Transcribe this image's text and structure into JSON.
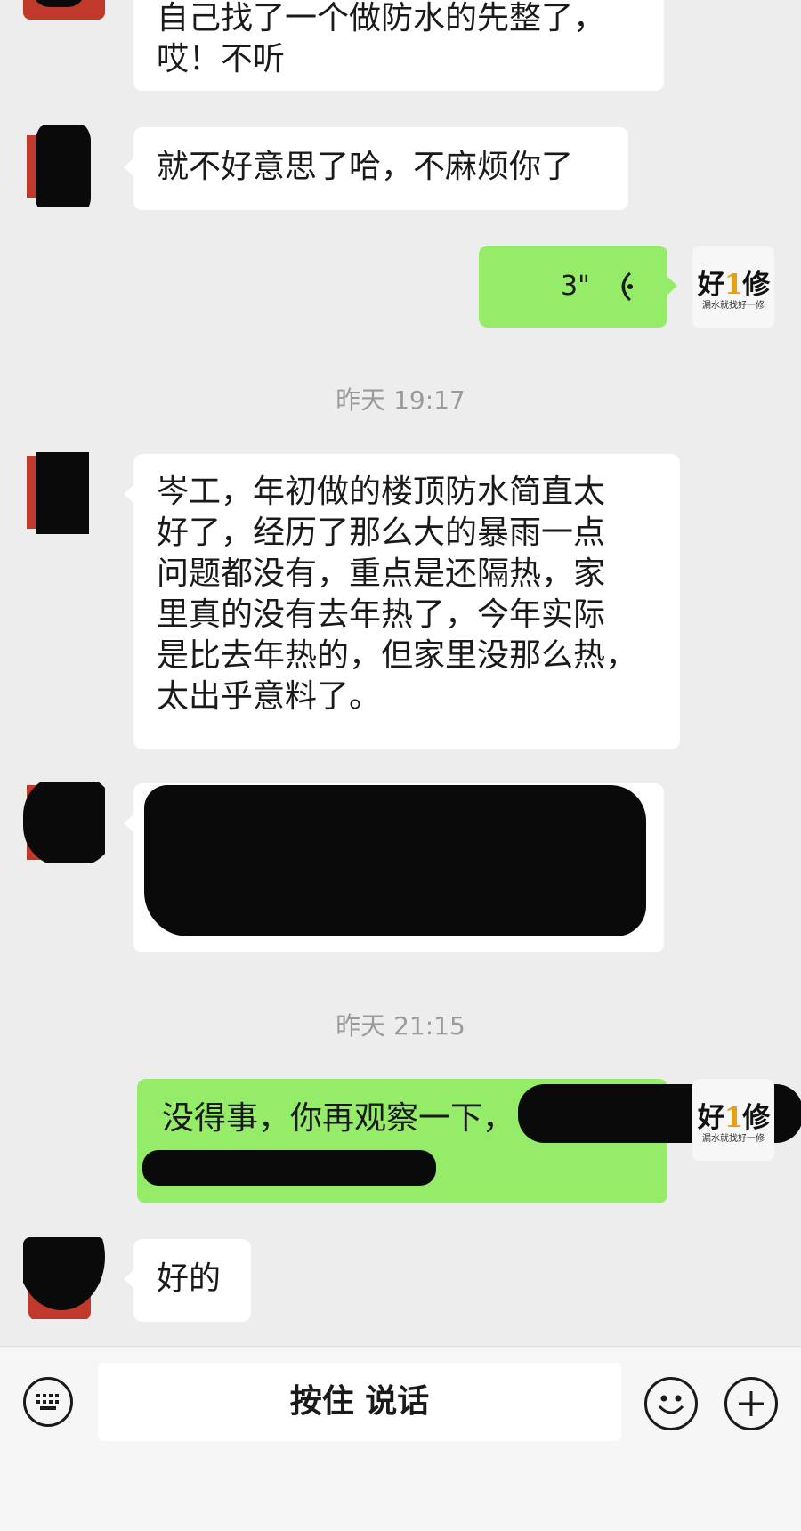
{
  "messages": [
    {
      "side": "left",
      "text_lines": [
        "自己找了一个做防水的先整了，",
        "哎！不听"
      ]
    },
    {
      "side": "left",
      "text": "就不好意思了哈，不麻烦你了"
    },
    {
      "side": "right",
      "type": "voice",
      "duration": "3\""
    },
    {
      "timestamp": "昨天 19:17"
    },
    {
      "side": "left",
      "text_lines": [
        "岑工，年初做的楼顶防水简直太",
        "好了，经历了那么大的暴雨一点",
        "问题都没有，重点是还隔热，家",
        "里真的没有去年热了，今年实际",
        "是比去年热的，但家里没那么热，",
        "太出乎意料了。"
      ]
    },
    {
      "side": "left",
      "type": "redacted"
    },
    {
      "timestamp": "昨天 21:15"
    },
    {
      "side": "right",
      "text": "没得事，你再观察一下，"
    },
    {
      "side": "left",
      "text": "好的"
    }
  ],
  "logo": {
    "main_prefix": "好",
    "main_num": "1",
    "main_suffix": "修",
    "tagline": "漏水就找好一修"
  },
  "input_bar": {
    "hold_to_talk": "按住 说话",
    "keyboard_icon": "keyboard-icon",
    "emoji_icon": "emoji-icon",
    "plus_icon": "plus-icon"
  },
  "colors": {
    "background": "#ededed",
    "green_bubble": "#95ec69",
    "white_bubble": "#ffffff",
    "timestamp": "#9a9a9a",
    "logo_accent": "#e8a013"
  }
}
